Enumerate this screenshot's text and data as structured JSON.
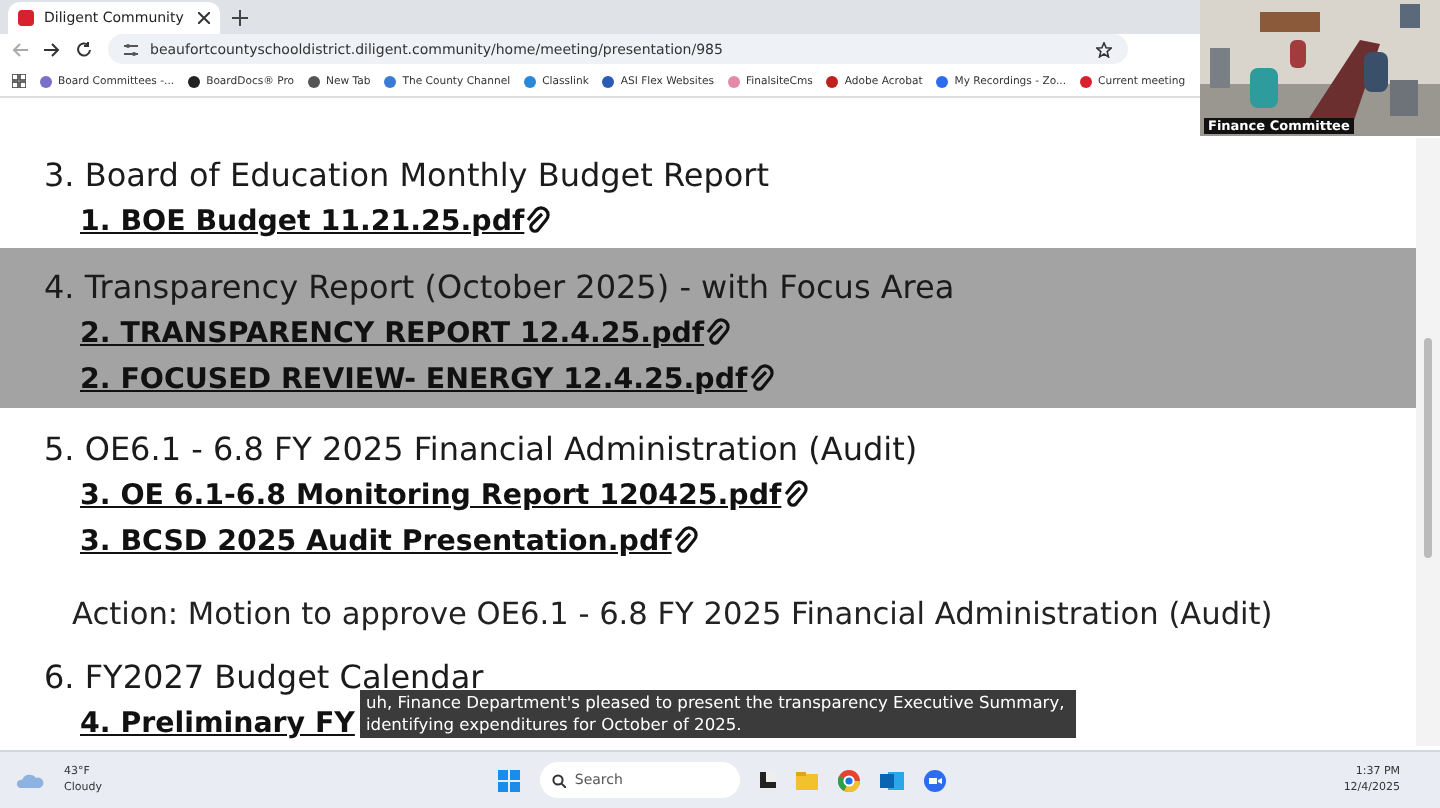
{
  "browser": {
    "tab_title": "Diligent Community",
    "url": "beaufortcountyschooldistrict.diligent.community/home/meeting/presentation/985",
    "bookmarks": [
      "Board Committees -...",
      "BoardDocs® Pro",
      "New Tab",
      "The County Channel",
      "Classlink",
      "ASI Flex Websites",
      "FinalsiteCms",
      "Adobe Acrobat",
      "My Recordings - Zo...",
      "Current meeting"
    ]
  },
  "video": {
    "label": "Finance Committee"
  },
  "agenda": [
    {
      "title": "3. Board of Education Monthly Budget Report",
      "highlighted": false,
      "links": [
        {
          "text": "1. BOE Budget 11.21.25.pdf",
          "clip": true
        }
      ]
    },
    {
      "title": "4. Transparency Report (October 2025) - with Focus Area",
      "highlighted": true,
      "links": [
        {
          "text": "2. TRANSPARENCY REPORT 12.4.25.pdf",
          "clip": true
        },
        {
          "text": "2. FOCUSED REVIEW- ENERGY 12.4.25.pdf",
          "clip": true
        }
      ]
    },
    {
      "title": "5. OE6.1 - 6.8 FY 2025 Financial Administration (Audit)",
      "highlighted": false,
      "links": [
        {
          "text": "3. OE 6.1-6.8 Monitoring Report 120425.pdf",
          "clip": true
        },
        {
          "text": "3. BCSD 2025 Audit Presentation.pdf",
          "clip": true
        }
      ],
      "action": "Action: Motion to approve OE6.1 - 6.8 FY 2025 Financial Administration (Audit)"
    },
    {
      "title": "6. FY2027 Budget Calendar",
      "highlighted": false,
      "links": [
        {
          "text": "4. Preliminary FY",
          "clip": false
        }
      ]
    }
  ],
  "caption": [
    "uh, Finance Department's pleased to present the transparency Executive Summary,",
    "identifying expenditures for October of 2025."
  ],
  "taskbar": {
    "temperature": "43°F",
    "weather": "Cloudy",
    "search_placeholder": "Search",
    "time": "1:37 PM",
    "date": "12/4/2025"
  }
}
